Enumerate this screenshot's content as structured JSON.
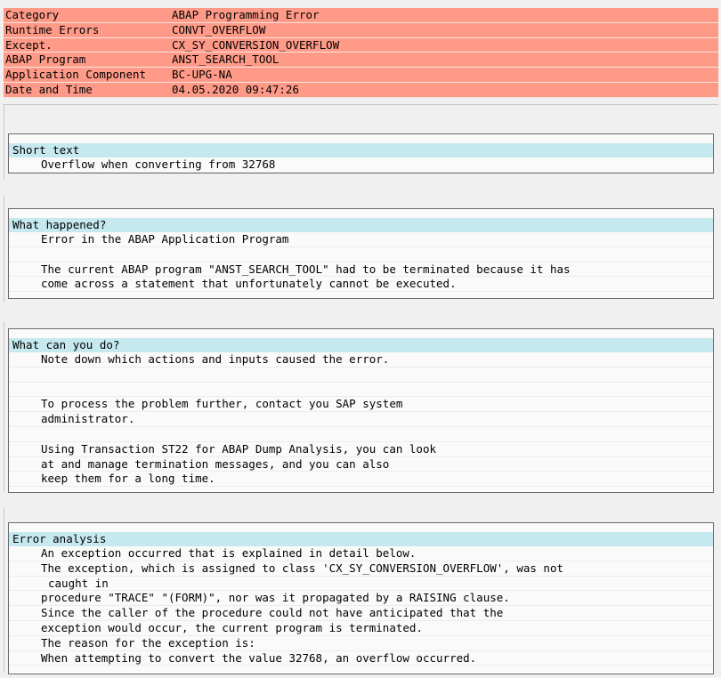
{
  "header": {
    "rows": [
      {
        "key": "Category",
        "value": "ABAP Programming Error"
      },
      {
        "key": "Runtime Errors",
        "value": "CONVT_OVERFLOW"
      },
      {
        "key": "Except.",
        "value": "CX_SY_CONVERSION_OVERFLOW"
      },
      {
        "key": "ABAP Program",
        "value": "ANST_SEARCH_TOOL"
      },
      {
        "key": "Application Component",
        "value": "BC-UPG-NA"
      },
      {
        "key": "Date and Time",
        "value": "04.05.2020 09:47:26"
      }
    ]
  },
  "sections": {
    "short_text": {
      "title": "Short text",
      "lines": [
        "Overflow when converting from 32768"
      ]
    },
    "what_happened": {
      "title": "What happened?",
      "lines": [
        "Error in the ABAP Application Program",
        "",
        "The current ABAP program \"ANST_SEARCH_TOOL\" had to be terminated because it has",
        "come across a statement that unfortunately cannot be executed."
      ]
    },
    "what_can_you_do": {
      "title": "What can you do?",
      "lines": [
        "Note down which actions and inputs caused the error.",
        "",
        "",
        "To process the problem further, contact you SAP system",
        "administrator.",
        "",
        "Using Transaction ST22 for ABAP Dump Analysis, you can look",
        "at and manage termination messages, and you can also",
        "keep them for a long time."
      ]
    },
    "error_analysis": {
      "title": "Error analysis",
      "lines": [
        "An exception occurred that is explained in detail below.",
        "The exception, which is assigned to class 'CX_SY_CONVERSION_OVERFLOW', was not",
        "caught in",
        "procedure \"TRACE\" \"(FORM)\", nor was it propagated by a RAISING clause.",
        "Since the caller of the procedure could not have anticipated that the",
        "exception would occur, the current program is terminated.",
        "The reason for the exception is:",
        "When attempting to convert the value 32768, an overflow occurred."
      ]
    }
  }
}
